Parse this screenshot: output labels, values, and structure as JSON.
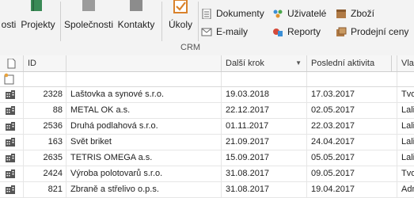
{
  "ribbon": {
    "big_buttons": [
      {
        "label": "osti",
        "icon": "partial-icon"
      },
      {
        "label": "Projekty",
        "icon": "projects-book-icon"
      },
      {
        "label": "Společnosti",
        "icon": "companies-icon"
      },
      {
        "label": "Kontakty",
        "icon": "contacts-icon"
      },
      {
        "label": "Úkoly",
        "icon": "tasks-checkbox-icon"
      }
    ],
    "small_buttons": [
      {
        "label": "Dokumenty",
        "icon": "document-icon"
      },
      {
        "label": "E-maily",
        "icon": "email-icon"
      },
      {
        "label": "Uživatelé",
        "icon": "users-icon"
      },
      {
        "label": "Reporty",
        "icon": "reports-icon"
      },
      {
        "label": "Zboží",
        "icon": "goods-box-icon"
      },
      {
        "label": "Prodejní ceny",
        "icon": "price-list-icon"
      }
    ],
    "group_label": "CRM"
  },
  "grid": {
    "columns": [
      "ID",
      "",
      "Další krok",
      "Poslední aktivita",
      "Vlas"
    ],
    "sort_column": "Další krok",
    "rows": [
      {
        "id": "2328",
        "name": "Laštovka a synové s.r.o.",
        "next_step": "19.03.2018",
        "last_activity": "17.03.2017",
        "owner": "Tvo"
      },
      {
        "id": "88",
        "name": "METAL OK a.s.",
        "next_step": "22.12.2017",
        "last_activity": "02.05.2017",
        "owner": "Lalin"
      },
      {
        "id": "2536",
        "name": "Druhá podlahová s.r.o.",
        "next_step": "01.11.2017",
        "last_activity": "22.03.2017",
        "owner": "Lalin"
      },
      {
        "id": "163",
        "name": "Svět briket",
        "next_step": "21.09.2017",
        "last_activity": "24.04.2017",
        "owner": "Lalin"
      },
      {
        "id": "2635",
        "name": "TETRIS OMEGA a.s.",
        "next_step": "15.09.2017",
        "last_activity": "05.05.2017",
        "owner": "Lalin"
      },
      {
        "id": "2424",
        "name": "Výroba polotovarů s.r.o.",
        "next_step": "31.08.2017",
        "last_activity": "09.05.2017",
        "owner": "Tvo"
      },
      {
        "id": "821",
        "name": "Zbraně a střelivo o.p.s.",
        "next_step": "31.08.2017",
        "last_activity": "19.04.2017",
        "owner": "Adm"
      }
    ]
  },
  "colors": {
    "accent_orange": "#e8a33d",
    "icon_gray": "#505050",
    "tasks_orange": "#d9822b"
  }
}
